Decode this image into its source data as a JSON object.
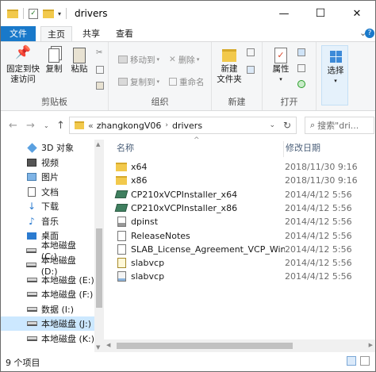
{
  "window": {
    "title": "drivers"
  },
  "title_controls": {
    "minimize": "—",
    "maximize": "☐",
    "close": "✕"
  },
  "tabs": {
    "file": "文件",
    "home": "主页",
    "share": "共享",
    "view": "查看"
  },
  "ribbon": {
    "pin": "固定到快\n速访问",
    "copy": "复制",
    "paste": "粘贴",
    "clipboard_group": "剪贴板",
    "move_to": "移动到",
    "copy_to": "复制到",
    "delete": "删除",
    "rename": "重命名",
    "organize_group": "组织",
    "new_folder": "新建\n文件夹",
    "new_group": "新建",
    "properties": "属性",
    "open_group": "打开",
    "select": "选择"
  },
  "address": {
    "path_prefix": "«",
    "crumbs": [
      "zhangkongV06",
      "drivers"
    ],
    "search_placeholder": "搜索\"dri..."
  },
  "nav": {
    "items": [
      {
        "label": "3D 对象",
        "icon": "3d-objects-icon",
        "selected": false
      },
      {
        "label": "视频",
        "icon": "video-icon",
        "selected": false
      },
      {
        "label": "图片",
        "icon": "pictures-icon",
        "selected": false
      },
      {
        "label": "文档",
        "icon": "documents-icon",
        "selected": false
      },
      {
        "label": "下载",
        "icon": "download-icon",
        "selected": false
      },
      {
        "label": "音乐",
        "icon": "music-icon",
        "selected": false
      },
      {
        "label": "桌面",
        "icon": "desktop-icon",
        "selected": false
      },
      {
        "label": "本地磁盘 (C:)",
        "icon": "drive-icon",
        "selected": false
      },
      {
        "label": "本地磁盘 (D:)",
        "icon": "drive-icon",
        "selected": false
      },
      {
        "label": "本地磁盘 (E:)",
        "icon": "drive-icon",
        "selected": false
      },
      {
        "label": "本地磁盘 (F:)",
        "icon": "drive-icon",
        "selected": false
      },
      {
        "label": "数据 (I:)",
        "icon": "drive-icon",
        "selected": false
      },
      {
        "label": "本地磁盘 (J:)",
        "icon": "drive-icon",
        "selected": true
      },
      {
        "label": "本地磁盘 (K:)",
        "icon": "drive-icon",
        "selected": false
      }
    ]
  },
  "columns": {
    "name": "名称",
    "modified": "修改日期"
  },
  "files": [
    {
      "name": "x64",
      "date": "2018/11/30 9:16",
      "icon": "folder-icon"
    },
    {
      "name": "x86",
      "date": "2018/11/30 9:16",
      "icon": "folder-icon"
    },
    {
      "name": "CP210xVCPInstaller_x64",
      "date": "2014/4/12 5:56",
      "icon": "installer-icon"
    },
    {
      "name": "CP210xVCPInstaller_x86",
      "date": "2014/4/12 5:56",
      "icon": "installer-icon"
    },
    {
      "name": "dpinst",
      "date": "2014/4/12 5:56",
      "icon": "config-icon"
    },
    {
      "name": "ReleaseNotes",
      "date": "2014/4/12 5:56",
      "icon": "text-file-icon"
    },
    {
      "name": "SLAB_License_Agreement_VCP_Windo...",
      "date": "2014/4/12 5:56",
      "icon": "text-file-icon"
    },
    {
      "name": "slabvcp",
      "date": "2014/4/12 5:56",
      "icon": "security-catalog-icon"
    },
    {
      "name": "slabvcp",
      "date": "2014/4/12 5:56",
      "icon": "setup-info-icon"
    }
  ],
  "status": {
    "count": "9 个项目"
  },
  "colors": {
    "accent": "#1979ca",
    "folder": "#f2c94c",
    "selected": "#cce8ff"
  }
}
